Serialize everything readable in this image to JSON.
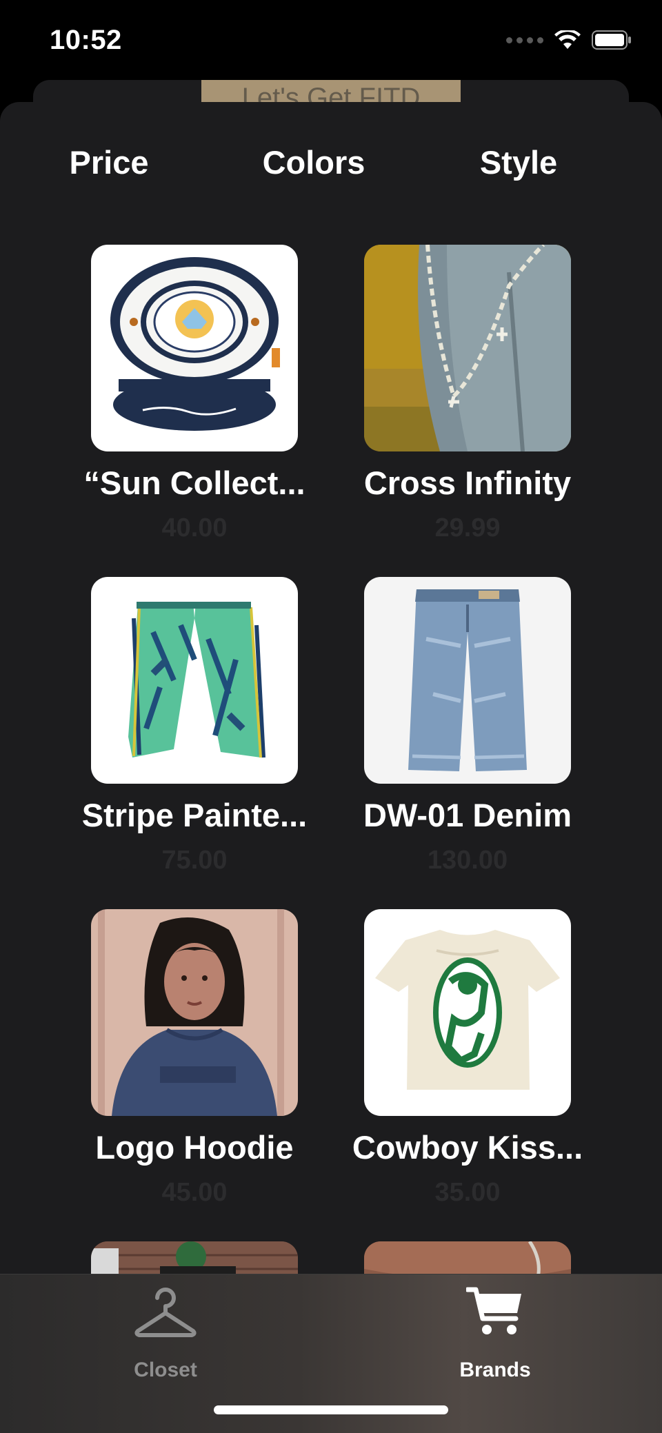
{
  "status_bar": {
    "time": "10:52",
    "icons": [
      "signal-icon",
      "wifi-icon",
      "battery-icon"
    ]
  },
  "background_screen": {
    "banner_text": "Let's Get FITD"
  },
  "filters": {
    "price": "Price",
    "colors": "Colors",
    "style": "Style"
  },
  "products": [
    {
      "name": "“Sun Collect...",
      "price": "40.00",
      "image": "navy-white-sun-collectors-cap-photo"
    },
    {
      "name": "Cross Infinity",
      "price": "29.99",
      "image": "chain-on-denim-photo"
    },
    {
      "name": "Stripe Painte...",
      "price": "75.00",
      "image": "green-tie-dye-pants-photo"
    },
    {
      "name": "DW-01 Denim",
      "price": "130.00",
      "image": "blue-baggy-denim-jeans-photo"
    },
    {
      "name": "Logo Hoodie",
      "price": "45.00",
      "image": "woman-in-navy-hoodie-photo"
    },
    {
      "name": "Cowboy Kiss...",
      "price": "35.00",
      "image": "cream-tee-green-print-photo"
    }
  ],
  "tab_bar": {
    "closet": "Closet",
    "brands": "Brands"
  },
  "colors": {
    "background": "#000000",
    "sheet": "#1c1c1e",
    "text": "#ffffff",
    "price_text": "#2c2c2e",
    "tab_inactive": "#8e8e8e",
    "tab_active": "#ffffff"
  }
}
